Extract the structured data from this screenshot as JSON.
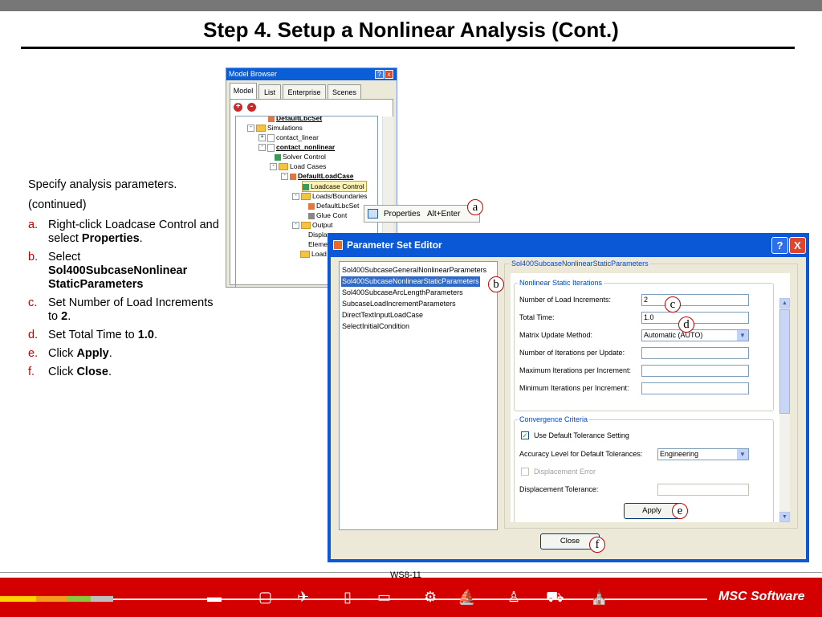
{
  "slide": {
    "title": "Step 4. Setup a Nonlinear Analysis (Cont.)",
    "page_number": "WS8-11",
    "brand": "MSC Software"
  },
  "instructions": {
    "intro": "Specify analysis parameters.",
    "continued": "(continued)",
    "steps": [
      {
        "marker": "a.",
        "parts": [
          "Right-click Loadcase Control and select ",
          "Properties",
          "."
        ]
      },
      {
        "marker": "b.",
        "parts": [
          "Select ",
          "Sol400SubcaseNonlinear StaticParameters",
          ""
        ]
      },
      {
        "marker": "c.",
        "parts": [
          "Set Number of Load Increments to ",
          "2",
          "."
        ]
      },
      {
        "marker": "d.",
        "parts": [
          "Set Total Time to ",
          "1.0",
          "."
        ]
      },
      {
        "marker": "e.",
        "parts": [
          "Click ",
          "Apply",
          "."
        ]
      },
      {
        "marker": "f.",
        "parts": [
          "Click ",
          "Close",
          "."
        ]
      }
    ]
  },
  "model_browser": {
    "title": "Model Browser",
    "help": "?",
    "close": "x",
    "tabs": [
      "Model",
      "List",
      "Enterprise",
      "Scenes"
    ],
    "add": "+",
    "remove": "-",
    "tree": {
      "default_lbc_set_top": "DefaultLbcSet",
      "simulations": "Simulations",
      "contact_linear": "contact_linear",
      "contact_nonlinear": "contact_nonlinear",
      "solver_control": "Solver Control",
      "load_cases": "Load Cases",
      "default_load_case": "DefaultLoadCase",
      "loadcase_control": "Loadcase Control",
      "loads_boundaries": "Loads/Boundaries",
      "default_lbc_set": "DefaultLbcSet",
      "glue": "Glue Cont",
      "output": "Output",
      "displac": "Displac",
      "element": "Element",
      "load_s": "Load S"
    }
  },
  "context_menu": {
    "label": "Properties",
    "shortcut": "Alt+Enter"
  },
  "callouts": {
    "a": "a",
    "b": "b",
    "c": "c",
    "d": "d",
    "e": "e",
    "f": "f"
  },
  "parameter_set_editor": {
    "title": "Parameter Set Editor",
    "help": "?",
    "close": "X",
    "parameter_sets": [
      "Sol400SubcaseGeneralNonlinearParameters",
      "Sol400SubcaseNonlinearStaticParameters",
      "Sol400SubcaseArcLengthParameters",
      "SubcaseLoadIncrementParameters",
      "DirectTextInputLoadCase",
      "SelectInitialCondition"
    ],
    "selected_index": 1,
    "group_title": "Sol400SubcaseNonlinearStaticParameters",
    "nonlinear_static_iterations": {
      "title": "Nonlinear Static Iterations",
      "num_load_increments_label": "Number of Load Increments:",
      "num_load_increments_value": "2",
      "total_time_label": "Total Time:",
      "total_time_value": "1.0",
      "matrix_update_label": "Matrix Update Method:",
      "matrix_update_value": "Automatic (AUTO)",
      "iter_per_update_label": "Number of Iterations per Update:",
      "iter_per_update_value": "",
      "max_iter_label": "Maximum Iterations per Increment:",
      "max_iter_value": "",
      "min_iter_label": "Minimum Iterations per Increment:",
      "min_iter_value": ""
    },
    "convergence_criteria": {
      "title": "Convergence Criteria",
      "use_default_tolerance_label": "Use Default Tolerance Setting",
      "use_default_tolerance_checked": true,
      "accuracy_level_label": "Accuracy Level for Default Tolerances:",
      "accuracy_level_value": "Engineering",
      "displacement_error_label": "Displacement Error",
      "displacement_error_checked": false,
      "displacement_tolerance_label": "Displacement Tolerance:",
      "displacement_tolerance_value": ""
    },
    "apply_label": "Apply",
    "close_label": "Close"
  },
  "colors": {
    "accent_red": "#c00000",
    "window_blue": "#0a58d6",
    "footer_red": "#d40000"
  }
}
